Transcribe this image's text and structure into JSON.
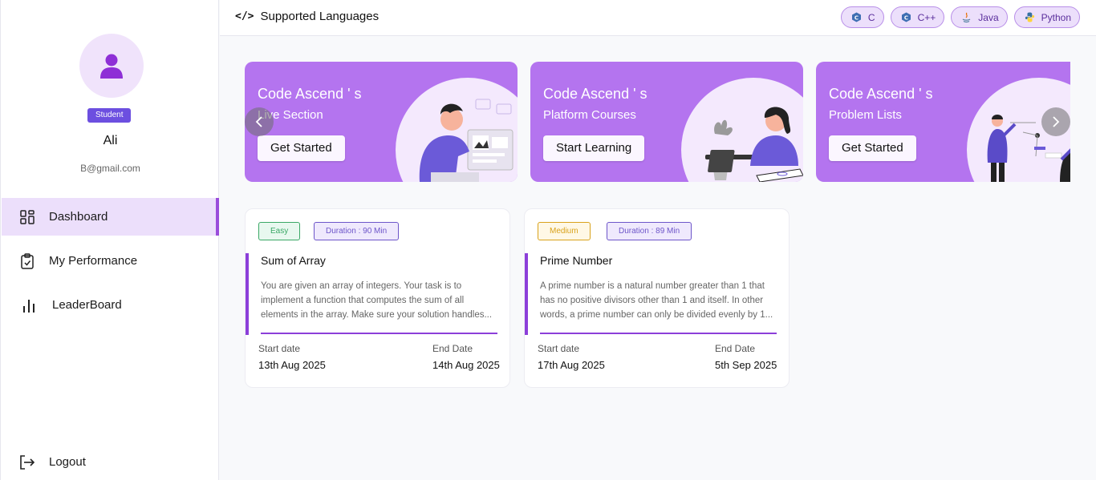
{
  "sidebar": {
    "role": "Student",
    "name": "Ali",
    "email": "B@gmail.com",
    "nav": [
      {
        "label": "Dashboard",
        "active": true
      },
      {
        "label": "My Performance",
        "active": false
      },
      {
        "label": "LeaderBoard",
        "active": false
      }
    ],
    "logout": "Logout"
  },
  "header": {
    "title": "Supported Languages",
    "languages": [
      {
        "label": "C",
        "icon": "c-lang-icon"
      },
      {
        "label": "C++",
        "icon": "cpp-lang-icon"
      },
      {
        "label": "Java",
        "icon": "java-icon"
      },
      {
        "label": "Python",
        "icon": "python-icon"
      }
    ]
  },
  "banners": [
    {
      "title": "Code Ascend ' s",
      "subtitle": "Live Section",
      "button": "Get Started"
    },
    {
      "title": "Code Ascend ' s",
      "subtitle": "Platform Courses",
      "button": "Start Learning"
    },
    {
      "title": "Code Ascend ' s",
      "subtitle": "Problem Lists",
      "button": "Get Started"
    }
  ],
  "problems": [
    {
      "difficulty": "Easy",
      "duration": "Duration : 90 Min",
      "title": "Sum of Array",
      "description": "You are given an array of integers. Your task is to implement a function that computes the sum of all elements in the array. Make sure your solution handles...",
      "start_label": "Start date",
      "start_value": "13th Aug 2025",
      "end_label": "End Date",
      "end_value": "14th Aug 2025"
    },
    {
      "difficulty": "Medium",
      "duration": "Duration : 89 Min",
      "title": "Prime Number",
      "description": "A prime number is a natural number greater than 1 that has no positive divisors other than 1 and itself. In other words, a prime number can only be divided evenly by 1...",
      "start_label": "Start date",
      "start_value": "17th Aug 2025",
      "end_label": "End Date",
      "end_value": "5th Sep 2025"
    }
  ],
  "colors": {
    "accent": "#8c3fd9",
    "banner": "#b474ef",
    "badge": "#6c4fe0"
  }
}
